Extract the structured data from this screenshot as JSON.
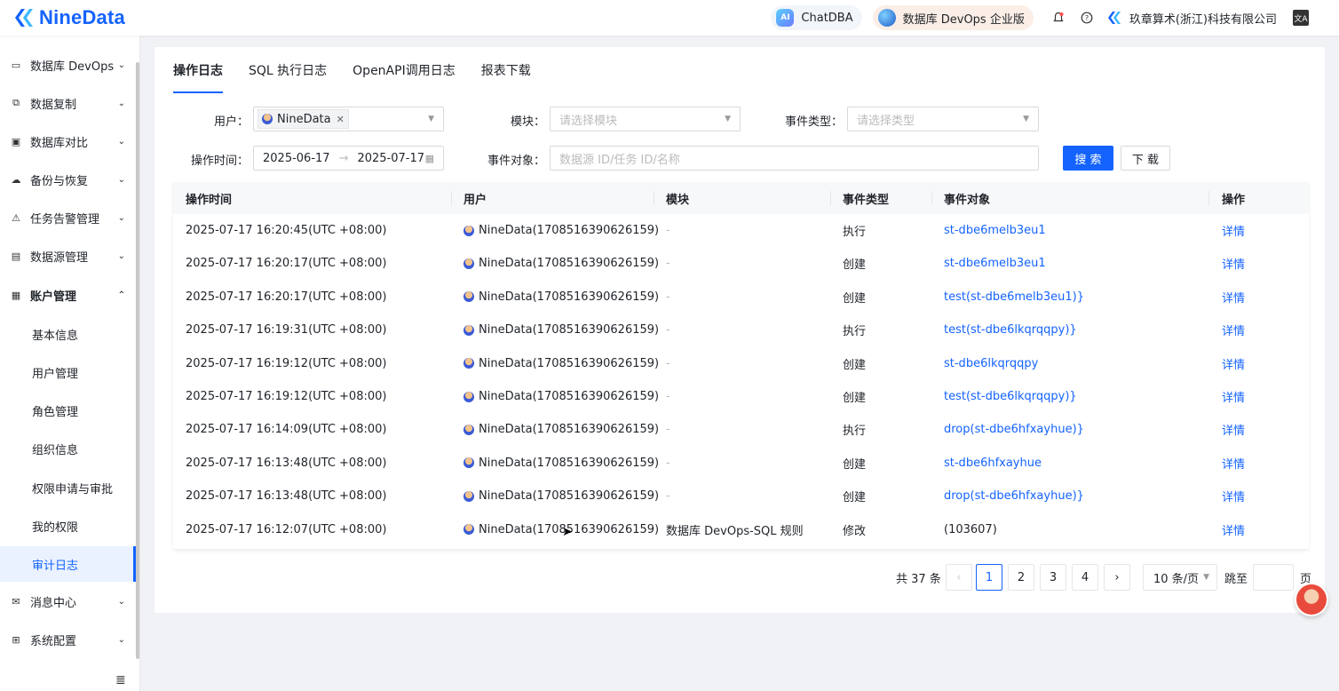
{
  "header": {
    "brand": "NineData",
    "chatdba": "ChatDBA",
    "ai_badge": "AI",
    "edition": "数据库 DevOps 企业版",
    "org": "玖章算术(浙江)科技有限公司",
    "lang_icon": "文A",
    "icons": [
      "bell-icon",
      "help-icon",
      "language-icon"
    ]
  },
  "sidebar": {
    "items": [
      {
        "label": "数据库 DevOps",
        "icon": "monitor-icon"
      },
      {
        "label": "数据复制",
        "icon": "copy-icon"
      },
      {
        "label": "数据库对比",
        "icon": "compare-icon"
      },
      {
        "label": "备份与恢复",
        "icon": "cloud-icon"
      },
      {
        "label": "任务告警管理",
        "icon": "alarm-icon"
      },
      {
        "label": "数据源管理",
        "icon": "datasource-icon"
      },
      {
        "label": "账户管理",
        "icon": "account-icon"
      }
    ],
    "account_sub": [
      "基本信息",
      "用户管理",
      "角色管理",
      "组织信息",
      "权限申请与审批",
      "我的权限",
      "审计日志"
    ],
    "bottom_items": [
      {
        "label": "消息中心",
        "icon": "mail-icon"
      },
      {
        "label": "系统配置",
        "icon": "grid-icon"
      }
    ]
  },
  "tabs": [
    "操作日志",
    "SQL 执行日志",
    "OpenAPI调用日志",
    "报表下载"
  ],
  "filters": {
    "user_label": "用户：",
    "user_tag": "NineData",
    "module_label": "模块：",
    "module_placeholder": "请选择模块",
    "event_type_label": "事件类型：",
    "event_type_placeholder": "请选择类型",
    "time_label": "操作时间：",
    "date_from": "2025-06-17",
    "date_sep": "→",
    "date_to": "2025-07-17",
    "target_label": "事件对象：",
    "target_placeholder": "数据源 ID/任务 ID/名称",
    "search_btn": "搜 索",
    "download_btn": "下 载"
  },
  "table": {
    "columns": [
      "操作时间",
      "用户",
      "模块",
      "事件类型",
      "事件对象",
      "操作"
    ],
    "rows": [
      [
        "2025-07-17 16:20:45(UTC +08:00)",
        "NineData(1708516390626159)",
        "-",
        "执行",
        "st-dbe6melb3eu1",
        "详情"
      ],
      [
        "2025-07-17 16:20:17(UTC +08:00)",
        "NineData(1708516390626159)",
        "-",
        "创建",
        "st-dbe6melb3eu1",
        "详情"
      ],
      [
        "2025-07-17 16:20:17(UTC +08:00)",
        "NineData(1708516390626159)",
        "-",
        "创建",
        "test(st-dbe6melb3eu1)}",
        "详情"
      ],
      [
        "2025-07-17 16:19:31(UTC +08:00)",
        "NineData(1708516390626159)",
        "-",
        "执行",
        "test(st-dbe6lkqrqqpy)}",
        "详情"
      ],
      [
        "2025-07-17 16:19:12(UTC +08:00)",
        "NineData(1708516390626159)",
        "-",
        "创建",
        "st-dbe6lkqrqqpy",
        "详情"
      ],
      [
        "2025-07-17 16:19:12(UTC +08:00)",
        "NineData(1708516390626159)",
        "-",
        "创建",
        "test(st-dbe6lkqrqqpy)}",
        "详情"
      ],
      [
        "2025-07-17 16:14:09(UTC +08:00)",
        "NineData(1708516390626159)",
        "-",
        "执行",
        "drop(st-dbe6hfxayhue)}",
        "详情"
      ],
      [
        "2025-07-17 16:13:48(UTC +08:00)",
        "NineData(1708516390626159)",
        "-",
        "创建",
        "st-dbe6hfxayhue",
        "详情"
      ],
      [
        "2025-07-17 16:13:48(UTC +08:00)",
        "NineData(1708516390626159)",
        "-",
        "创建",
        "drop(st-dbe6hfxayhue)}",
        "详情"
      ],
      [
        "2025-07-17 16:12:07(UTC +08:00)",
        "NineData(1708516390626159)",
        "数据库 DevOps-SQL 规则",
        "修改",
        "(103607)",
        "详情"
      ]
    ]
  },
  "pagination": {
    "total": "共 37 条",
    "pages": [
      "1",
      "2",
      "3",
      "4"
    ],
    "current": "1",
    "page_size": "10 条/页",
    "jump_label": "跳至",
    "page_suffix": "页"
  },
  "colors": {
    "accent": "#1463ff"
  }
}
